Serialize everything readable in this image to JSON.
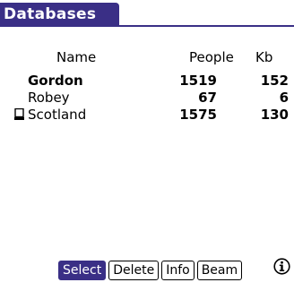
{
  "app": {
    "title": "Databases"
  },
  "columns": {
    "name": "Name",
    "people": "People",
    "kb": "Kb"
  },
  "rows": [
    {
      "name": "Gordon",
      "people": "1519",
      "kb": "152",
      "bold": true,
      "icon": ""
    },
    {
      "name": "Robey",
      "people": "67",
      "kb": "6",
      "bold": false,
      "icon": ""
    },
    {
      "name": "Scotland",
      "people": "1575",
      "kb": "130",
      "bold": false,
      "icon": "device-icon"
    }
  ],
  "buttons": {
    "select": "Select",
    "delete": "Delete",
    "info": "Info",
    "beam": "Beam"
  },
  "colors": {
    "accent": "#3a2f86",
    "background": "#ffffff"
  },
  "icons": {
    "info": "info-icon"
  }
}
